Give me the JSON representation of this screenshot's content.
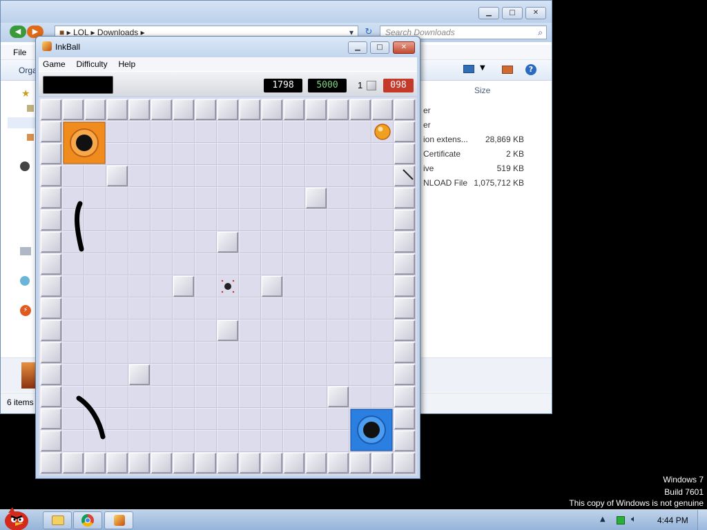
{
  "explorer": {
    "breadcrumb": [
      "LOL",
      "Downloads"
    ],
    "search_placeholder": "Search Downloads",
    "menu_file": "File",
    "cmd_organize": "Orga",
    "col_size": "Size",
    "files": [
      {
        "name": "er",
        "size": ""
      },
      {
        "name": "er",
        "size": ""
      },
      {
        "name": "ion extens...",
        "size": "28,869 KB"
      },
      {
        "name": "Certificate",
        "size": "2 KB"
      },
      {
        "name": "ive",
        "size": "519 KB"
      },
      {
        "name": "NLOAD File",
        "size": "1,075,712 KB"
      }
    ],
    "status": "6 items"
  },
  "inkball": {
    "title": "InkBall",
    "menu": [
      "Game",
      "Difficulty",
      "Help"
    ],
    "score": "1798",
    "target": "5000",
    "balls_remaining": "1",
    "timer": "098"
  },
  "watermark": {
    "line1": "Windows 7",
    "line2": "Build 7601",
    "line3": "This copy of Windows is not genuine"
  },
  "taskbar": {
    "clock": "4:44 PM"
  },
  "colors": {
    "hole_orange": "#f08c1e",
    "hole_blue": "#2a7fe0",
    "ball_orange": "#f0a020",
    "timer_bg": "#c43a2a",
    "target_fg": "#7ed67e"
  }
}
